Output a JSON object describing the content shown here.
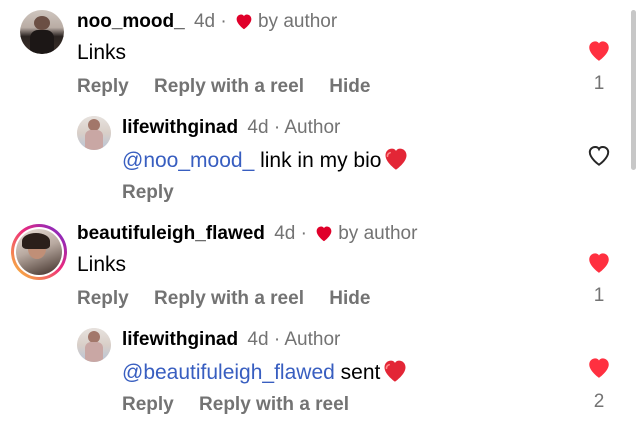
{
  "comments": [
    {
      "username": "noo_mood_",
      "time": "4d",
      "separator": "·",
      "liked_by": "by author",
      "text": "Links",
      "actions": [
        "Reply",
        "Reply with a reel",
        "Hide"
      ],
      "likes": "1",
      "liked": true,
      "replies": [
        {
          "username": "lifewithginad",
          "time": "4d",
          "separator": "·",
          "badge": "Author",
          "mention": "@noo_mood_",
          "text": " link in my bio",
          "actions": [
            "Reply"
          ],
          "likes": "",
          "liked": false
        }
      ]
    },
    {
      "username": "beautifuleigh_flawed",
      "time": "4d",
      "separator": "·",
      "liked_by": "by author",
      "text": "Links",
      "actions": [
        "Reply",
        "Reply with a reel",
        "Hide"
      ],
      "likes": "1",
      "liked": true,
      "replies": [
        {
          "username": "lifewithginad",
          "time": "4d",
          "separator": "·",
          "badge": "Author",
          "mention": "@beautifuleigh_flawed",
          "text": " sent",
          "actions": [
            "Reply",
            "Reply with a reel"
          ],
          "likes": "2",
          "liked": true
        }
      ]
    }
  ],
  "colors": {
    "like_red": "#ff3040",
    "mention_blue": "#385ec0",
    "muted": "#737373"
  }
}
